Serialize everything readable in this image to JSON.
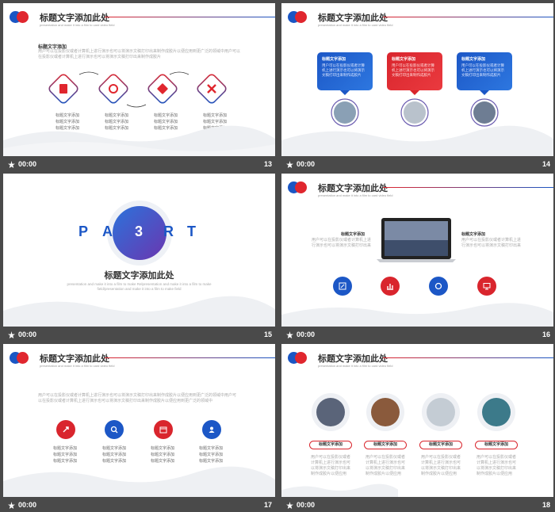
{
  "common": {
    "title": "标题文字添加此处",
    "subtitle": "presentation and make it into a film to card video field",
    "duration": "00:00"
  },
  "slides": [
    {
      "number": "13",
      "section_title": "标题文字添加",
      "body": "用户可以在投影仪或者计算机上进行演示也可以将演示文稿打印出来制作成胶片以便应用到更广泛的领域中用户可以在投影仪或者计算机上进行演示也可以将演示文稿打印出来制作成胶片",
      "labels": [
        "标题文字添加",
        "标题文字添加",
        "标题文字添加"
      ]
    },
    {
      "number": "14",
      "boxes": [
        {
          "title": "标题文字添加",
          "body": "用户可以在投影仪或者计算机上进行演示也可以将演示文稿打印出来制作成胶片"
        },
        {
          "title": "标题文字添加",
          "body": "用户可以在投影仪或者计算机上进行演示也可以将演示文稿打印出来制作成胶片"
        },
        {
          "title": "标题文字添加",
          "body": "用户可以在投影仪或者计算机上进行演示也可以将演示文稿打印出来制作成胶片"
        }
      ]
    },
    {
      "number": "15",
      "letters": [
        "P",
        "A",
        "3",
        "R",
        "T"
      ],
      "part_title": "标题文字添加此处",
      "part_sub": "presentation and make it into a film to make Relpresentation and make it into a film to make field/presentation and make it into a film to make field"
    },
    {
      "number": "16",
      "left_title": "标题文字添加",
      "left_body": "用户可以在投影仪或者计算机上进行演示也可以将演示文稿打印出来",
      "right_title": "标题文字添加",
      "right_body": "用户可以在投影仪或者计算机上进行演示也可以将演示文稿打印出来"
    },
    {
      "number": "17",
      "body": "用户可以在投影仪或者计算机上进行演示也可以将演示文稿打印出来制作成胶片以便应用到更广泛的领域中用户可以在投影仪或者计算机上进行演示也可以将演示文稿打印出来制作成胶片以便应用到更广泛的领域中",
      "labels": [
        "标题文字添加",
        "标题文字添加",
        "标题文字添加"
      ]
    },
    {
      "number": "18",
      "tag": "标题文字添加",
      "body": "用户可以在投影仪或者计算机上进行演示也可以将演示文稿打印出来制作成胶片以便应用"
    }
  ]
}
